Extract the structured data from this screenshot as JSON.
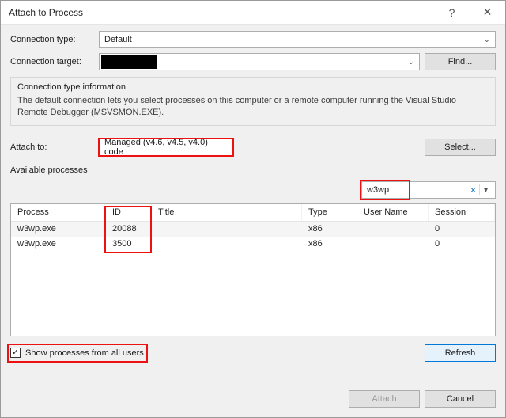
{
  "titlebar": {
    "title": "Attach to Process",
    "help": "?",
    "close": "✕"
  },
  "connection_type": {
    "label": "Connection type:",
    "value": "Default"
  },
  "connection_target": {
    "label": "Connection target:",
    "value": "",
    "find_label": "Find..."
  },
  "conn_info": {
    "title": "Connection type information",
    "text": "The default connection lets you select processes on this computer or a remote computer running the Visual Studio Remote Debugger (MSVSMON.EXE)."
  },
  "attach_to": {
    "label": "Attach to:",
    "value": "Managed (v4.6, v4.5, v4.0) code",
    "select_label": "Select..."
  },
  "available": {
    "label": "Available processes",
    "search_value": "w3wp",
    "columns": {
      "process": "Process",
      "id": "ID",
      "title": "Title",
      "type": "Type",
      "user": "User Name",
      "session": "Session"
    },
    "rows": [
      {
        "process": "w3wp.exe",
        "id": "20088",
        "title": "",
        "type": "x86",
        "user": "",
        "session": "0"
      },
      {
        "process": "w3wp.exe",
        "id": "3500",
        "title": "",
        "type": "x86",
        "user": "",
        "session": "0"
      }
    ]
  },
  "footer": {
    "show_all_label": "Show processes from all users",
    "show_all_checked": "✓",
    "refresh_label": "Refresh",
    "attach_label": "Attach",
    "cancel_label": "Cancel"
  }
}
